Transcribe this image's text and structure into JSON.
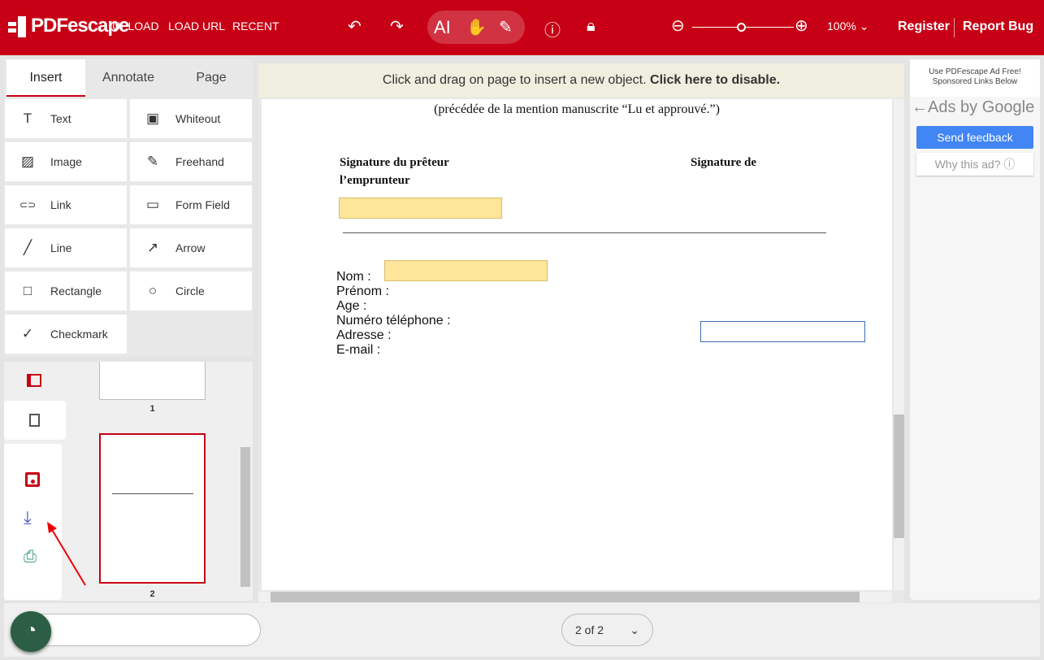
{
  "header": {
    "logo": "PDFescape",
    "nav": [
      "UPLOAD",
      "LOAD URL",
      "RECENT"
    ],
    "zoom": "100%",
    "register": "Register",
    "report_bug": "Report Bug"
  },
  "tabs": [
    {
      "label": "Insert",
      "active": true
    },
    {
      "label": "Annotate"
    },
    {
      "label": "Page"
    }
  ],
  "tools": [
    {
      "label": "Text",
      "icon": "T"
    },
    {
      "label": "Whiteout",
      "icon": "▣"
    },
    {
      "label": "Image",
      "icon": "▨"
    },
    {
      "label": "Freehand",
      "icon": "✎"
    },
    {
      "label": "Link",
      "icon": "⊂⊃"
    },
    {
      "label": "Form Field",
      "icon": "▭"
    },
    {
      "label": "Line",
      "icon": "╱"
    },
    {
      "label": "Arrow",
      "icon": "↗"
    },
    {
      "label": "Rectangle",
      "icon": "□"
    },
    {
      "label": "Circle",
      "icon": "○"
    },
    {
      "label": "Checkmark",
      "icon": "✓"
    }
  ],
  "thumbnails": [
    {
      "label": "1"
    },
    {
      "label": "2",
      "selected": true
    }
  ],
  "notice": {
    "text": "Click and drag on page to insert a new object. ",
    "link": "Click here to disable."
  },
  "document": {
    "subtitle": "(précédée de la mention manuscrite “Lu et approuvé.”)",
    "sig_lender": "Signature du prêteur",
    "sig_borrower_part": "Signature de",
    "borrower": "l’emprunteur",
    "fields": [
      "Nom :",
      "Prénom :",
      "Age :",
      "Numéro téléphone :",
      "Adresse :",
      "E-mail :"
    ]
  },
  "ad": {
    "line1": "Use PDFescape Ad Free!",
    "line2": "Sponsored Links Below",
    "ads_by": "Ads by Google",
    "feedback": "Send feedback",
    "why": "Why this ad? ⓘ"
  },
  "pager": {
    "label": "2 of 2"
  },
  "colors": {
    "brand": "#c70015",
    "field": "#fde69a",
    "feedback": "#4285f4"
  }
}
